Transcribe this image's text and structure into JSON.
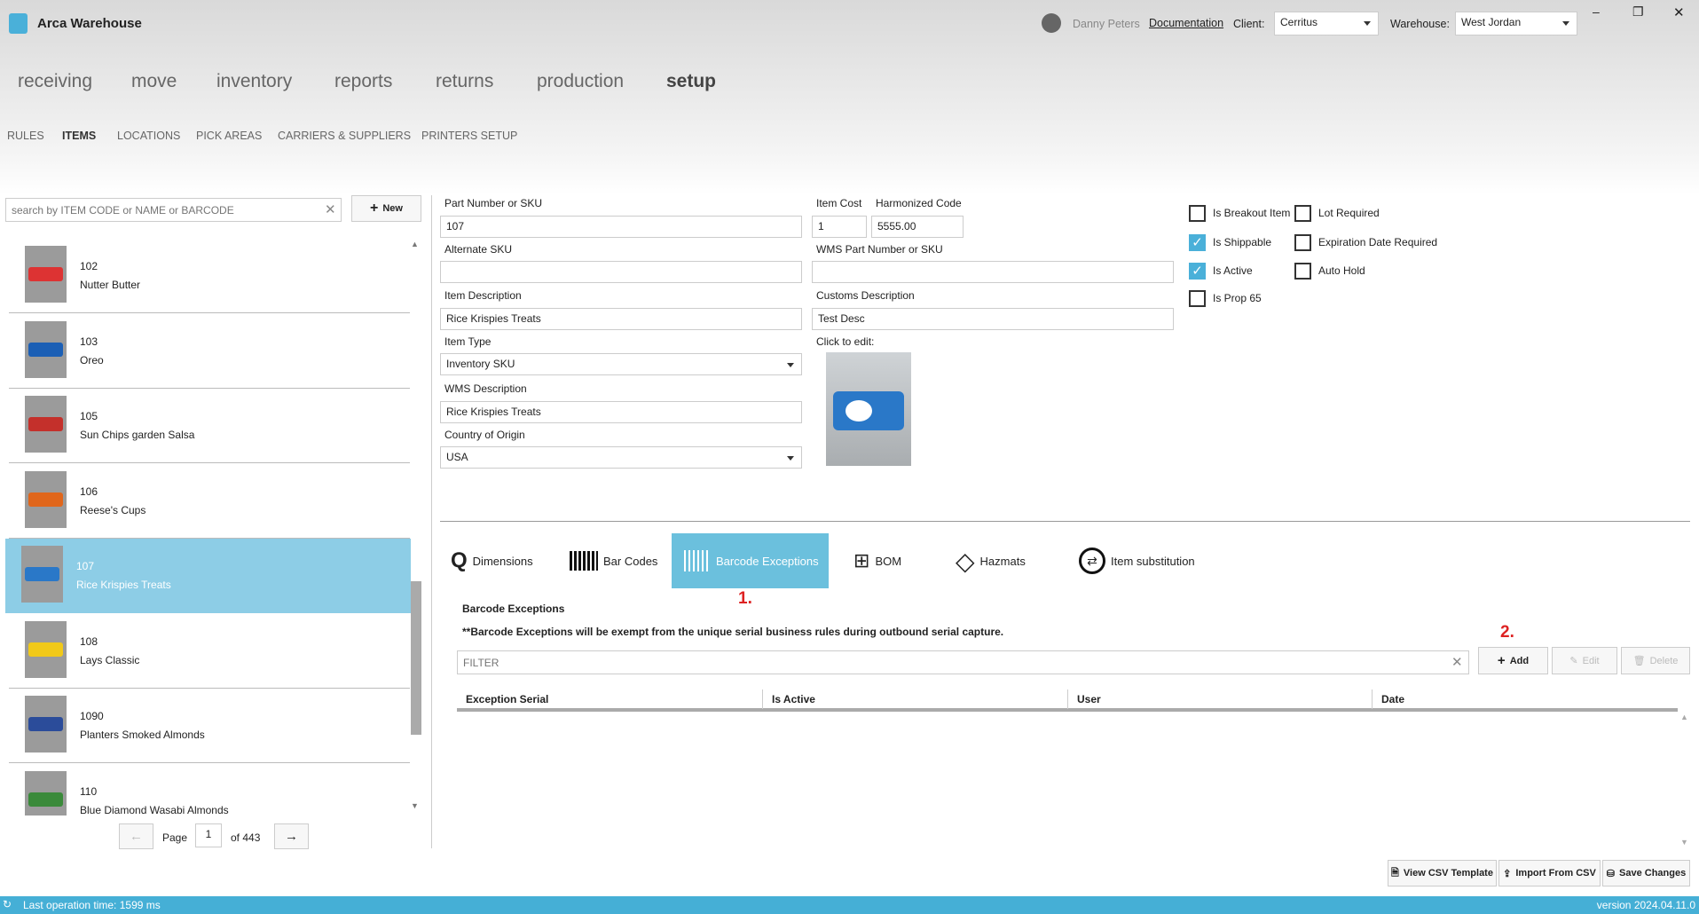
{
  "app": {
    "title": "Arca Warehouse",
    "user": "Danny Peters",
    "documentation": "Documentation",
    "client_label": "Client:",
    "client_value": "Cerritus",
    "warehouse_label": "Warehouse:",
    "warehouse_value": "West Jordan"
  },
  "window_controls": {
    "minimize": "–",
    "restore": "❐",
    "close": "✕"
  },
  "nav": [
    "receiving",
    "move",
    "inventory",
    "reports",
    "returns",
    "production",
    "setup"
  ],
  "subnav": [
    "RULES",
    "ITEMS",
    "LOCATIONS",
    "PICK AREAS",
    "CARRIERS & SUPPLIERS",
    "PRINTERS SETUP"
  ],
  "search": {
    "placeholder": "search by ITEM CODE or NAME or BARCODE",
    "new_label": "New"
  },
  "items": [
    {
      "code": "102",
      "name": "Nutter Butter",
      "color": "#d33"
    },
    {
      "code": "103",
      "name": "Oreo",
      "color": "#1b5fb5"
    },
    {
      "code": "105",
      "name": "Sun Chips garden Salsa",
      "color": "#c4302b"
    },
    {
      "code": "106",
      "name": "Reese's Cups",
      "color": "#e0661b"
    },
    {
      "code": "107",
      "name": "Rice Krispies Treats",
      "color": "#2a78c8"
    },
    {
      "code": "108",
      "name": "Lays Classic",
      "color": "#f1c919"
    },
    {
      "code": "1090",
      "name": "Planters Smoked Almonds",
      "color": "#2b4c9a"
    },
    {
      "code": "110",
      "name": "Blue Diamond Wasabi Almonds",
      "color": "#3a8a3a"
    }
  ],
  "pager": {
    "page_label": "Page",
    "page": "1",
    "of_label": "of 443"
  },
  "form": {
    "part_label": "Part Number or SKU",
    "part": "107",
    "cost_label": "Item Cost",
    "cost": "1",
    "harm_label": "Harmonized Code",
    "harm": "5555.00",
    "alt_label": "Alternate SKU",
    "alt": "",
    "wms_part_label": "WMS Part Number or SKU",
    "wms_part": "",
    "desc_label": "Item Description",
    "desc": "Rice Krispies Treats",
    "customs_label": "Customs Description",
    "customs": "Test Desc",
    "type_label": "Item Type",
    "type": "Inventory SKU",
    "click_edit": "Click to edit:",
    "wms_desc_label": "WMS Description",
    "wms_desc": "Rice Krispies Treats",
    "country_label": "Country of Origin",
    "country": "USA"
  },
  "checkboxes": [
    {
      "label": "Is Breakout Item",
      "checked": false
    },
    {
      "label": "Is Shippable",
      "checked": true
    },
    {
      "label": "Is Active",
      "checked": true
    },
    {
      "label": "Is Prop 65",
      "checked": false
    },
    {
      "label": "Lot Required",
      "checked": false
    },
    {
      "label": "Expiration Date Required",
      "checked": false
    },
    {
      "label": "Auto Hold",
      "checked": false
    }
  ],
  "tabs": [
    "Dimensions",
    "Bar Codes",
    "Barcode Exceptions",
    "BOM",
    "Hazmats",
    "Item substitution"
  ],
  "annotations": {
    "one": "1.",
    "two": "2."
  },
  "exceptions": {
    "title": "Barcode Exceptions",
    "note": "**Barcode Exceptions will be exempt from the unique serial business rules during outbound serial capture.",
    "filter_placeholder": "FILTER",
    "add": "Add",
    "edit": "Edit",
    "delete": "Delete",
    "columns": [
      "Exception Serial",
      "Is Active",
      "User",
      "Date"
    ]
  },
  "footer": {
    "view_csv": "View CSV Template",
    "import_csv": "Import From CSV",
    "save": "Save Changes"
  },
  "status": {
    "text": "Last operation time: 1599 ms",
    "version": "version 2024.04.11.0",
    "color": "#45afd6"
  }
}
